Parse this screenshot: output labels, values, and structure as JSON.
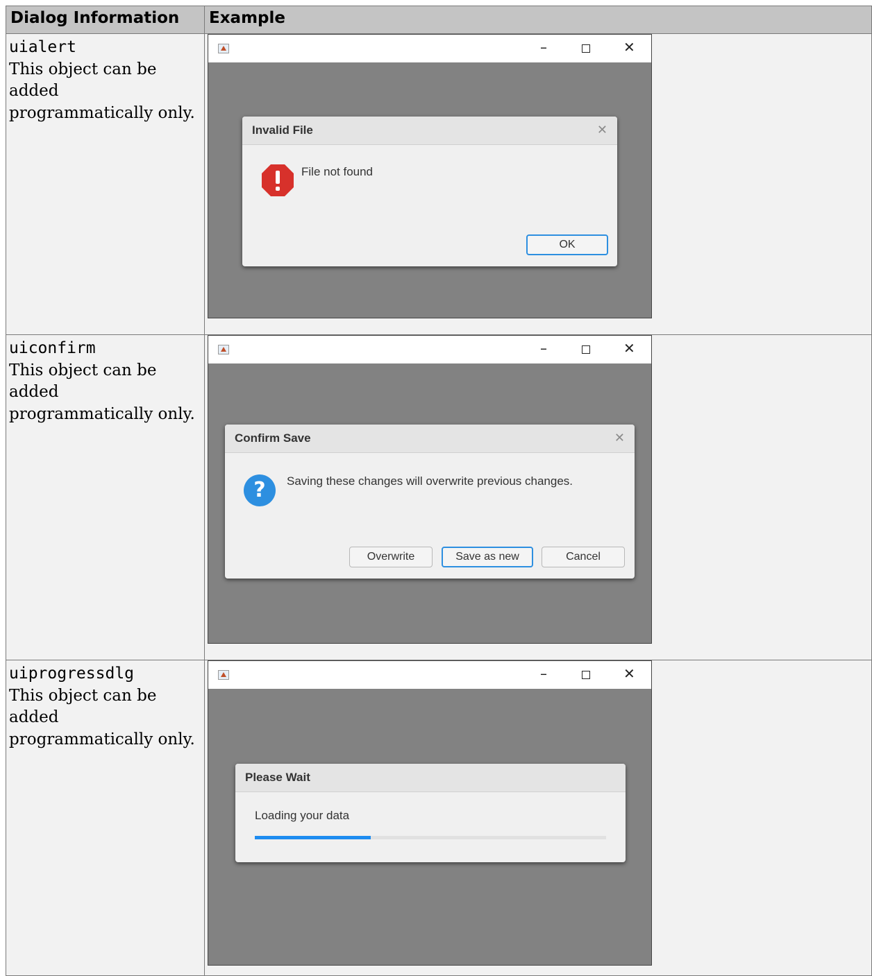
{
  "table": {
    "headers": [
      "Dialog Information",
      "Example"
    ],
    "rows": [
      {
        "function_name": "uialert",
        "description": "This object can be added programmatically only.",
        "example": {
          "window_controls": {
            "minimize": "–",
            "close": "✕"
          },
          "dialog": {
            "title": "Invalid File",
            "close_glyph": "✕",
            "icon": "error-icon",
            "message": "File not found",
            "buttons": [
              "OK"
            ]
          }
        }
      },
      {
        "function_name": "uiconfirm",
        "description": "This object can be added programmatically only.",
        "example": {
          "window_controls": {
            "minimize": "–",
            "close": "✕"
          },
          "dialog": {
            "title": "Confirm Save",
            "close_glyph": "✕",
            "icon": "question-icon",
            "icon_glyph": "?",
            "message": "Saving these changes will overwrite previous changes.",
            "buttons": [
              "Overwrite",
              "Save as new",
              "Cancel"
            ]
          }
        }
      },
      {
        "function_name": "uiprogressdlg",
        "description": "This object can be added programmatically only.",
        "example": {
          "window_controls": {
            "minimize": "–",
            "close": "✕"
          },
          "dialog": {
            "title": "Please Wait",
            "message": "Loading your data",
            "progress": 0.33
          }
        }
      }
    ]
  },
  "colors": {
    "header_bg": "#c4c4c4",
    "cell_bg": "#f2f2f2",
    "figure_bg": "#828282",
    "accent": "#2d8fe0",
    "error": "#d7312b"
  }
}
